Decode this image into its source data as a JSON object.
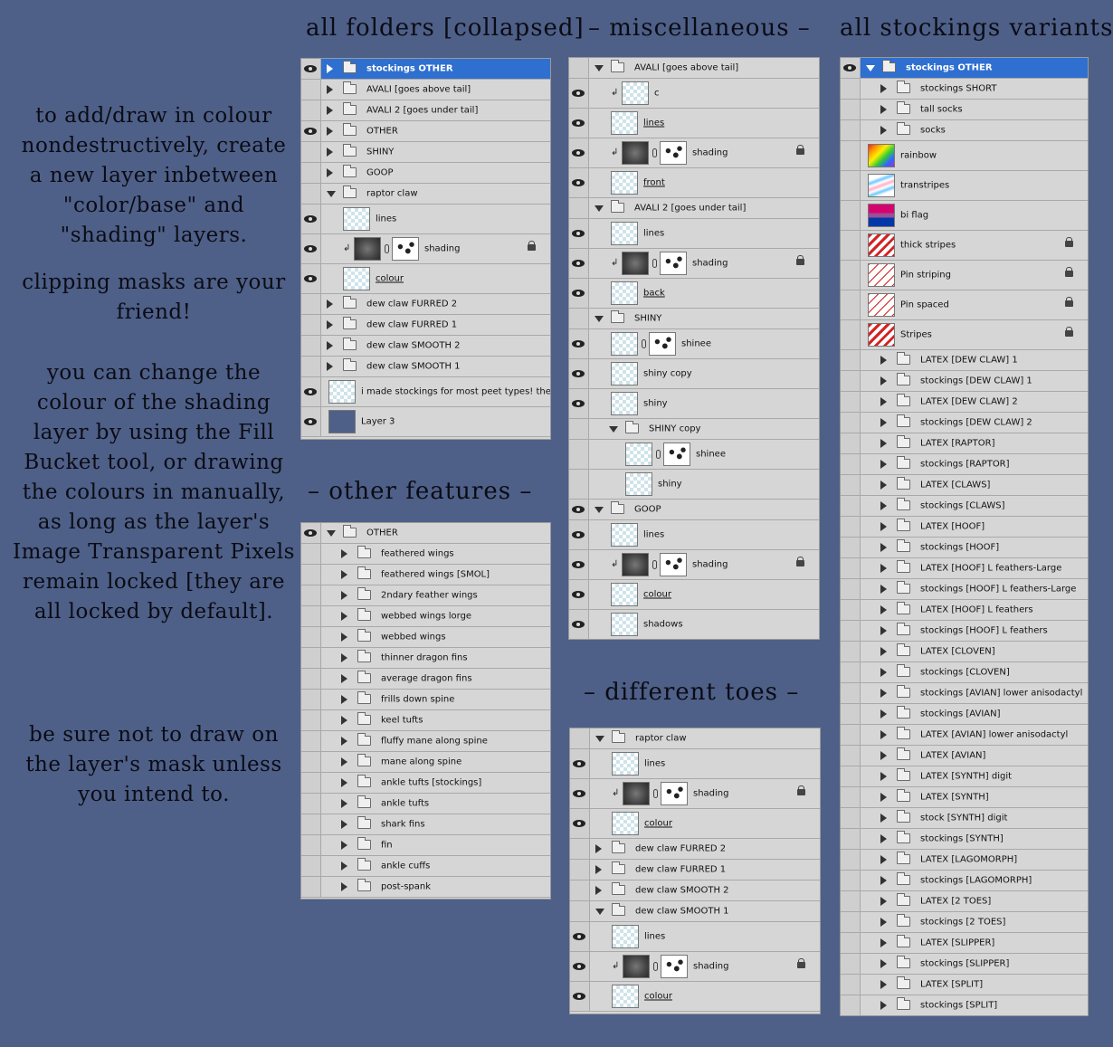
{
  "headings": {
    "all_folders": "all folders [collapsed]",
    "misc": "– miscellaneous –",
    "all_stockings": "all stockings variants",
    "other_features": "– other features –",
    "different_toes": "– different toes –"
  },
  "notes": {
    "p1": "to add/draw in colour nondestructively, create a new layer inbetween \"color/base\" and \"shading\" layers.",
    "p2": "clipping masks are your friend!",
    "p3": "you can change the colour of the shading layer by using the Fill Bucket tool, or drawing the colours in manually, as long as the layer's Image Transparent Pixels remain locked [they are all locked by default].",
    "p4": "be sure not to draw on the layer's mask unless you intend to."
  },
  "panel_all_folders": [
    {
      "label": "stockings OTHER",
      "kind": "folder",
      "eye": true,
      "expanded": false,
      "selected": true
    },
    {
      "label": "AVALI [goes above tail]",
      "kind": "folder",
      "eye": false,
      "expanded": false
    },
    {
      "label": "AVALI 2 [goes under tail]",
      "kind": "folder",
      "eye": false,
      "expanded": false
    },
    {
      "label": "OTHER",
      "kind": "folder",
      "eye": true,
      "expanded": false
    },
    {
      "label": "SHINY",
      "kind": "folder",
      "eye": false,
      "expanded": false
    },
    {
      "label": "GOOP",
      "kind": "folder",
      "eye": false,
      "expanded": false
    },
    {
      "label": "raptor claw",
      "kind": "folder",
      "eye": false,
      "expanded": true
    },
    {
      "label": "lines",
      "kind": "layer",
      "eye": true,
      "indent": 1
    },
    {
      "label": "shading",
      "kind": "masked",
      "eye": true,
      "indent": 1,
      "lock": true
    },
    {
      "label": "colour",
      "kind": "layer",
      "eye": true,
      "indent": 1,
      "underline": true
    },
    {
      "label": "dew claw FURRED 2",
      "kind": "folder",
      "eye": false,
      "expanded": false
    },
    {
      "label": "dew claw FURRED 1",
      "kind": "folder",
      "eye": false,
      "expanded": false
    },
    {
      "label": "dew claw SMOOTH 2",
      "kind": "folder",
      "eye": false,
      "expanded": false
    },
    {
      "label": "dew claw SMOOTH 1",
      "kind": "folder",
      "eye": false,
      "expanded": false
    },
    {
      "label": "i made stockings for most peet types!  the...",
      "kind": "layer",
      "eye": true
    },
    {
      "label": "Layer 3",
      "kind": "layer",
      "eye": true,
      "thumb": "solid"
    }
  ],
  "panel_other_features": [
    {
      "label": "OTHER",
      "kind": "folder",
      "eye": true,
      "expanded": true
    },
    {
      "label": "feathered wings",
      "kind": "folder",
      "eye": false,
      "expanded": false,
      "indent": 1
    },
    {
      "label": "feathered wings [SMOL]",
      "kind": "folder",
      "eye": false,
      "expanded": false,
      "indent": 1
    },
    {
      "label": "2ndary feather wings",
      "kind": "folder",
      "eye": false,
      "expanded": false,
      "indent": 1
    },
    {
      "label": "webbed wings lorge",
      "kind": "folder",
      "eye": false,
      "expanded": false,
      "indent": 1
    },
    {
      "label": "webbed wings",
      "kind": "folder",
      "eye": false,
      "expanded": false,
      "indent": 1
    },
    {
      "label": "thinner dragon fins",
      "kind": "folder",
      "eye": false,
      "expanded": false,
      "indent": 1
    },
    {
      "label": "average dragon fins",
      "kind": "folder",
      "eye": false,
      "expanded": false,
      "indent": 1
    },
    {
      "label": "frills down spine",
      "kind": "folder",
      "eye": false,
      "expanded": false,
      "indent": 1
    },
    {
      "label": "keel tufts",
      "kind": "folder",
      "eye": false,
      "expanded": false,
      "indent": 1
    },
    {
      "label": "fluffy mane along spine",
      "kind": "folder",
      "eye": false,
      "expanded": false,
      "indent": 1
    },
    {
      "label": "mane along spine",
      "kind": "folder",
      "eye": false,
      "expanded": false,
      "indent": 1
    },
    {
      "label": "ankle tufts [stockings]",
      "kind": "folder",
      "eye": false,
      "expanded": false,
      "indent": 1
    },
    {
      "label": "ankle tufts",
      "kind": "folder",
      "eye": false,
      "expanded": false,
      "indent": 1
    },
    {
      "label": "shark fins",
      "kind": "folder",
      "eye": false,
      "expanded": false,
      "indent": 1
    },
    {
      "label": "fin",
      "kind": "folder",
      "eye": false,
      "expanded": false,
      "indent": 1
    },
    {
      "label": "ankle cuffs",
      "kind": "folder",
      "eye": false,
      "expanded": false,
      "indent": 1
    },
    {
      "label": "post-spank",
      "kind": "folder",
      "eye": false,
      "expanded": false,
      "indent": 1
    }
  ],
  "panel_misc": [
    {
      "label": "AVALI [goes above tail]",
      "kind": "folder",
      "eye": false,
      "expanded": true
    },
    {
      "label": "c",
      "kind": "clipped",
      "eye": true,
      "indent": 1
    },
    {
      "label": "lines",
      "kind": "layer",
      "eye": true,
      "indent": 1,
      "underline": true
    },
    {
      "label": "shading",
      "kind": "masked",
      "eye": true,
      "indent": 1,
      "lock": true
    },
    {
      "label": "front",
      "kind": "layer",
      "eye": true,
      "indent": 1,
      "underline": true
    },
    {
      "label": "AVALI 2 [goes under tail]",
      "kind": "folder",
      "eye": false,
      "expanded": true
    },
    {
      "label": "lines",
      "kind": "layer",
      "eye": true,
      "indent": 1
    },
    {
      "label": "shading",
      "kind": "masked",
      "eye": true,
      "indent": 1,
      "lock": true
    },
    {
      "label": "back",
      "kind": "layer",
      "eye": true,
      "indent": 1,
      "underline": true
    },
    {
      "label": "SHINY",
      "kind": "folder",
      "eye": false,
      "expanded": true
    },
    {
      "label": "shinee",
      "kind": "linked",
      "eye": true,
      "indent": 1
    },
    {
      "label": "shiny copy",
      "kind": "layer",
      "eye": true,
      "indent": 1
    },
    {
      "label": "shiny",
      "kind": "layer",
      "eye": true,
      "indent": 1
    },
    {
      "label": "SHINY copy",
      "kind": "folder",
      "eye": false,
      "expanded": true,
      "indent": 1
    },
    {
      "label": "shinee",
      "kind": "linked",
      "eye": false,
      "indent": 2
    },
    {
      "label": "shiny",
      "kind": "layer",
      "eye": false,
      "indent": 2
    },
    {
      "label": "GOOP",
      "kind": "folder",
      "eye": true,
      "expanded": true
    },
    {
      "label": "lines",
      "kind": "layer",
      "eye": true,
      "indent": 1
    },
    {
      "label": "shading",
      "kind": "masked",
      "eye": true,
      "indent": 1,
      "lock": true
    },
    {
      "label": "colour",
      "kind": "layer",
      "eye": true,
      "indent": 1,
      "underline": true
    },
    {
      "label": "shadows",
      "kind": "layer",
      "eye": true,
      "indent": 1
    }
  ],
  "panel_toes": [
    {
      "label": "raptor claw",
      "kind": "folder",
      "eye": false,
      "expanded": true
    },
    {
      "label": "lines",
      "kind": "layer",
      "eye": true,
      "indent": 1
    },
    {
      "label": "shading",
      "kind": "masked",
      "eye": true,
      "indent": 1,
      "lock": true
    },
    {
      "label": "colour",
      "kind": "layer",
      "eye": true,
      "indent": 1,
      "underline": true
    },
    {
      "label": "dew claw FURRED 2",
      "kind": "folder",
      "eye": false,
      "expanded": false
    },
    {
      "label": "dew claw FURRED 1",
      "kind": "folder",
      "eye": false,
      "expanded": false
    },
    {
      "label": "dew claw SMOOTH 2",
      "kind": "folder",
      "eye": false,
      "expanded": false
    },
    {
      "label": "dew claw SMOOTH 1",
      "kind": "folder",
      "eye": false,
      "expanded": true
    },
    {
      "label": "lines",
      "kind": "layer",
      "eye": true,
      "indent": 1
    },
    {
      "label": "shading",
      "kind": "masked",
      "eye": true,
      "indent": 1,
      "lock": true
    },
    {
      "label": "colour",
      "kind": "layer",
      "eye": true,
      "indent": 1,
      "underline": true
    }
  ],
  "panel_stockings": [
    {
      "label": "stockings OTHER",
      "kind": "folder",
      "eye": true,
      "expanded": true,
      "selected": true
    },
    {
      "label": "stockings SHORT",
      "kind": "folder",
      "eye": false,
      "expanded": false,
      "indent": 1
    },
    {
      "label": "tall socks",
      "kind": "folder",
      "eye": false,
      "expanded": false,
      "indent": 1
    },
    {
      "label": "socks",
      "kind": "folder",
      "eye": false,
      "expanded": false,
      "indent": 1
    },
    {
      "label": "rainbow",
      "kind": "layer",
      "eye": false,
      "thumb": "rainbow"
    },
    {
      "label": "transtripes",
      "kind": "layer",
      "eye": false,
      "thumb": "trans"
    },
    {
      "label": "bi flag",
      "kind": "layer",
      "eye": false,
      "thumb": "biflag"
    },
    {
      "label": "thick stripes",
      "kind": "layer",
      "eye": false,
      "thumb": "stripes",
      "lock": true
    },
    {
      "label": "Pin striping",
      "kind": "layer",
      "eye": false,
      "thumb": "pinstripe",
      "lock": true
    },
    {
      "label": "Pin spaced",
      "kind": "layer",
      "eye": false,
      "thumb": "pinstripe",
      "lock": true
    },
    {
      "label": "Stripes",
      "kind": "layer",
      "eye": false,
      "thumb": "stripes",
      "lock": true
    },
    {
      "label": "LATEX [DEW CLAW] 1",
      "kind": "folder",
      "eye": false,
      "expanded": false,
      "indent": 1
    },
    {
      "label": "stockings [DEW CLAW] 1",
      "kind": "folder",
      "eye": false,
      "expanded": false,
      "indent": 1
    },
    {
      "label": "LATEX [DEW CLAW] 2",
      "kind": "folder",
      "eye": false,
      "expanded": false,
      "indent": 1
    },
    {
      "label": "stockings [DEW CLAW] 2",
      "kind": "folder",
      "eye": false,
      "expanded": false,
      "indent": 1
    },
    {
      "label": "LATEX [RAPTOR]",
      "kind": "folder",
      "eye": false,
      "expanded": false,
      "indent": 1
    },
    {
      "label": "stockings [RAPTOR]",
      "kind": "folder",
      "eye": false,
      "expanded": false,
      "indent": 1
    },
    {
      "label": "LATEX [CLAWS]",
      "kind": "folder",
      "eye": false,
      "expanded": false,
      "indent": 1
    },
    {
      "label": "stockings [CLAWS]",
      "kind": "folder",
      "eye": false,
      "expanded": false,
      "indent": 1
    },
    {
      "label": "LATEX [HOOF]",
      "kind": "folder",
      "eye": false,
      "expanded": false,
      "indent": 1
    },
    {
      "label": "stockings [HOOF]",
      "kind": "folder",
      "eye": false,
      "expanded": false,
      "indent": 1
    },
    {
      "label": "LATEX [HOOF] L feathers-Large",
      "kind": "folder",
      "eye": false,
      "expanded": false,
      "indent": 1
    },
    {
      "label": "stockings [HOOF] L feathers-Large",
      "kind": "folder",
      "eye": false,
      "expanded": false,
      "indent": 1
    },
    {
      "label": "LATEX [HOOF] L feathers",
      "kind": "folder",
      "eye": false,
      "expanded": false,
      "indent": 1
    },
    {
      "label": "stockings [HOOF] L feathers",
      "kind": "folder",
      "eye": false,
      "expanded": false,
      "indent": 1
    },
    {
      "label": "LATEX [CLOVEN]",
      "kind": "folder",
      "eye": false,
      "expanded": false,
      "indent": 1
    },
    {
      "label": "stockings [CLOVEN]",
      "kind": "folder",
      "eye": false,
      "expanded": false,
      "indent": 1
    },
    {
      "label": "stockings [AVIAN] lower anisodactyl",
      "kind": "folder",
      "eye": false,
      "expanded": false,
      "indent": 1
    },
    {
      "label": "stockings [AVIAN]",
      "kind": "folder",
      "eye": false,
      "expanded": false,
      "indent": 1
    },
    {
      "label": "LATEX [AVIAN] lower anisodactyl",
      "kind": "folder",
      "eye": false,
      "expanded": false,
      "indent": 1
    },
    {
      "label": "LATEX [AVIAN]",
      "kind": "folder",
      "eye": false,
      "expanded": false,
      "indent": 1
    },
    {
      "label": "LATEX [SYNTH] digit",
      "kind": "folder",
      "eye": false,
      "expanded": false,
      "indent": 1
    },
    {
      "label": "LATEX [SYNTH]",
      "kind": "folder",
      "eye": false,
      "expanded": false,
      "indent": 1
    },
    {
      "label": "stock [SYNTH] digit",
      "kind": "folder",
      "eye": false,
      "expanded": false,
      "indent": 1
    },
    {
      "label": "stockings [SYNTH]",
      "kind": "folder",
      "eye": false,
      "expanded": false,
      "indent": 1
    },
    {
      "label": "LATEX [LAGOMORPH]",
      "kind": "folder",
      "eye": false,
      "expanded": false,
      "indent": 1
    },
    {
      "label": "stockings [LAGOMORPH]",
      "kind": "folder",
      "eye": false,
      "expanded": false,
      "indent": 1
    },
    {
      "label": "LATEX [2 TOES]",
      "kind": "folder",
      "eye": false,
      "expanded": false,
      "indent": 1
    },
    {
      "label": "stockings [2 TOES]",
      "kind": "folder",
      "eye": false,
      "expanded": false,
      "indent": 1
    },
    {
      "label": "LATEX [SLIPPER]",
      "kind": "folder",
      "eye": false,
      "expanded": false,
      "indent": 1
    },
    {
      "label": "stockings [SLIPPER]",
      "kind": "folder",
      "eye": false,
      "expanded": false,
      "indent": 1
    },
    {
      "label": "LATEX [SPLIT]",
      "kind": "folder",
      "eye": false,
      "expanded": false,
      "indent": 1
    },
    {
      "label": "stockings [SPLIT]",
      "kind": "folder",
      "eye": false,
      "expanded": false,
      "indent": 1
    }
  ]
}
